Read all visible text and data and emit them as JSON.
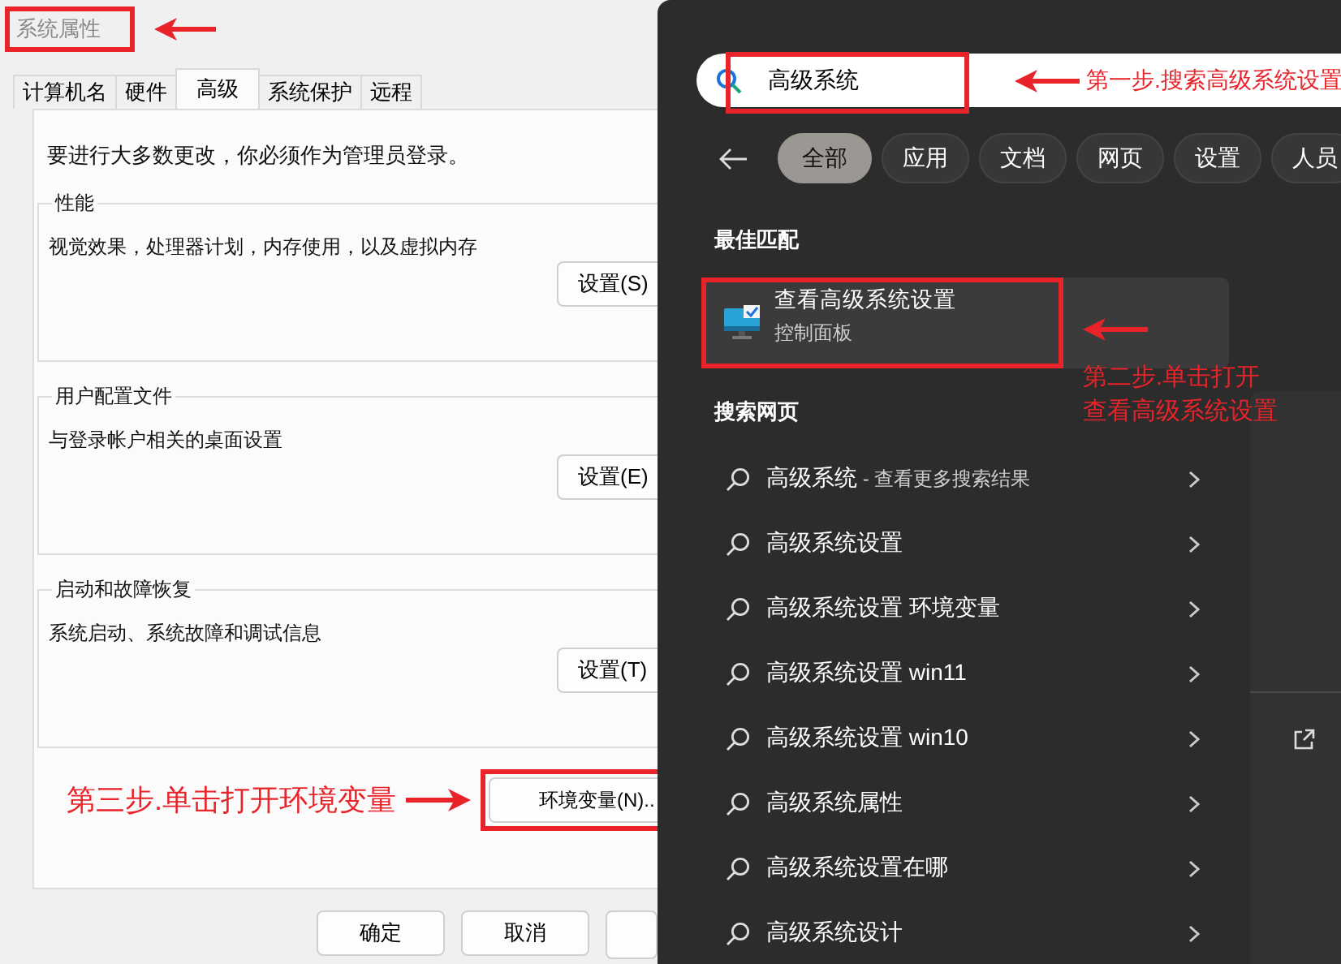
{
  "dialog": {
    "title": "系统属性",
    "tabs": [
      {
        "label": "计算机名",
        "selected": false
      },
      {
        "label": "硬件",
        "selected": false
      },
      {
        "label": "高级",
        "selected": true
      },
      {
        "label": "系统保护",
        "selected": false
      },
      {
        "label": "远程",
        "selected": false
      }
    ],
    "notice": "要进行大多数更改，你必须作为管理员登录。",
    "groups": [
      {
        "title": "性能",
        "description": "视觉效果，处理器计划，内存使用，以及虚拟内存",
        "button": "设置(S)"
      },
      {
        "title": "用户配置文件",
        "description": "与登录帐户相关的桌面设置",
        "button": "设置(E)"
      },
      {
        "title": "启动和故障恢复",
        "description": "系统启动、系统故障和调试信息",
        "button": "设置(T)"
      }
    ],
    "env_button": "环境变量(N)..",
    "footer_buttons": [
      "确定",
      "取消"
    ]
  },
  "search": {
    "query": "高级系统",
    "filters": [
      {
        "label": "全部",
        "selected": true
      },
      {
        "label": "应用",
        "selected": false
      },
      {
        "label": "文档",
        "selected": false
      },
      {
        "label": "网页",
        "selected": false
      },
      {
        "label": "设置",
        "selected": false
      },
      {
        "label": "人员",
        "selected": false
      }
    ],
    "best_match_heading": "最佳匹配",
    "best_match": {
      "title": "查看高级系统设置",
      "subtitle": "控制面板"
    },
    "web_heading": "搜索网页",
    "results": [
      {
        "kind": "more",
        "text": "高级系统",
        "suffix": " - 查看更多搜索结果"
      },
      {
        "kind": "query",
        "text": "高级系统设置"
      },
      {
        "kind": "query",
        "text": "高级系统设置 环境变量"
      },
      {
        "kind": "query",
        "text": "高级系统设置 win11"
      },
      {
        "kind": "query",
        "text": "高级系统设置 win10"
      },
      {
        "kind": "query",
        "text": "高级系统属性"
      },
      {
        "kind": "query",
        "text": "高级系统设置在哪"
      },
      {
        "kind": "query",
        "text": "高级系统设计"
      }
    ]
  },
  "annotations": {
    "step1": "第一步.搜索高级系统设置",
    "step2": [
      "第二步.单击打开",
      "查看高级系统设置"
    ],
    "step3": "第三步.单击打开环境变量"
  }
}
